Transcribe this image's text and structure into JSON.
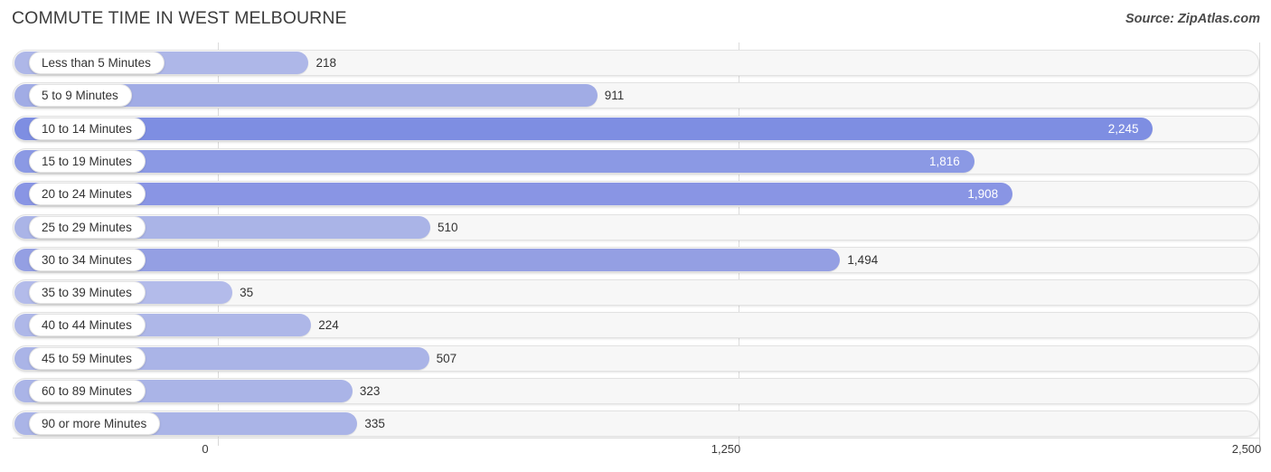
{
  "header": {
    "title": "COMMUTE TIME IN WEST MELBOURNE",
    "source": "Source: ZipAtlas.com"
  },
  "chart_data": {
    "type": "bar",
    "orientation": "horizontal",
    "title": "COMMUTE TIME IN WEST MELBOURNE",
    "subtitle": "",
    "xlabel": "",
    "ylabel": "",
    "xlim": [
      0,
      2500
    ],
    "grid": true,
    "legend": null,
    "x_ticks": [
      "0",
      "1,250",
      "2,500"
    ],
    "x_tick_values": [
      0,
      1250,
      2500
    ],
    "categories": [
      "Less than 5 Minutes",
      "5 to 9 Minutes",
      "10 to 14 Minutes",
      "15 to 19 Minutes",
      "20 to 24 Minutes",
      "25 to 29 Minutes",
      "30 to 34 Minutes",
      "35 to 39 Minutes",
      "40 to 44 Minutes",
      "45 to 59 Minutes",
      "60 to 89 Minutes",
      "90 or more Minutes"
    ],
    "values": [
      218,
      911,
      2245,
      1816,
      1908,
      510,
      1494,
      35,
      224,
      507,
      323,
      335
    ],
    "value_labels": [
      "218",
      "911",
      "2,245",
      "1,816",
      "1,908",
      "510",
      "1,494",
      "35",
      "224",
      "507",
      "323",
      "335"
    ],
    "bar_colors": [
      "#aeb7e8",
      "#a1ace5",
      "#7e8ee2",
      "#8b99e4",
      "#8995e4",
      "#aab4e7",
      "#949fe3",
      "#b3bbea",
      "#aeb7e8",
      "#aab4e7",
      "#aab4e7",
      "#aab4e7"
    ],
    "label_inside": [
      false,
      false,
      true,
      true,
      true,
      false,
      false,
      false,
      false,
      false,
      false,
      false
    ],
    "track_color": "#f7f7f7",
    "grid_color": "#dcdcdc",
    "text_color": "#333333"
  }
}
